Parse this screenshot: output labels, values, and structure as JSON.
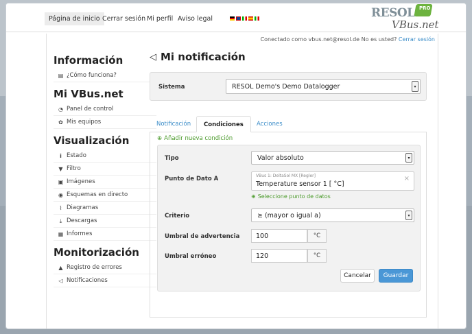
{
  "nav": {
    "home": "Página de inicio",
    "logout": "Cerrar sesión",
    "profile": "Mi perfil",
    "legal": "Aviso legal"
  },
  "logo": {
    "brand": "RESOL",
    "badge": "PRO",
    "product": "VBus.net"
  },
  "connection": {
    "text": "Conectado como vbus.net@resol.de No es usted?",
    "link": "Cerrar sesión"
  },
  "sidebar": {
    "info_title": "Información",
    "info_items": [
      {
        "label": "¿Cómo funciona?",
        "icon": "book-icon"
      }
    ],
    "vbus_title": "Mi VBus.net",
    "vbus_items": [
      {
        "label": "Panel de control",
        "icon": "dashboard-icon"
      },
      {
        "label": "Mis equipos",
        "icon": "gear-icon"
      }
    ],
    "vis_title": "Visualización",
    "vis_items": [
      {
        "label": "Estado",
        "icon": "info-icon"
      },
      {
        "label": "Filtro",
        "icon": "filter-icon"
      },
      {
        "label": "Imágenes",
        "icon": "image-icon"
      },
      {
        "label": "Esquemas en directo",
        "icon": "eye-icon"
      },
      {
        "label": "Diagramas",
        "icon": "chart-icon"
      },
      {
        "label": "Descargas",
        "icon": "download-icon"
      },
      {
        "label": "Informes",
        "icon": "report-icon"
      }
    ],
    "mon_title": "Monitorización",
    "mon_items": [
      {
        "label": "Registro de errores",
        "icon": "warning-icon"
      },
      {
        "label": "Notificaciones",
        "icon": "megaphone-icon"
      }
    ]
  },
  "main": {
    "title": "Mi notificación",
    "system_label": "Sistema",
    "system_value": "RESOL Demo's Demo Datalogger",
    "tabs": [
      "Notificación",
      "Condiciones",
      "Acciones"
    ],
    "active_tab": "Condiciones",
    "add_condition": "Añadir nueva condición",
    "type_label": "Tipo",
    "type_value": "Valor absoluto",
    "datapoint_label": "Punto de Dato A",
    "datapoint_small": "VBus 1: DeltaSol MX [Regler]",
    "datapoint_value": "Temperature sensor 1 [ °C]",
    "select_datapoint": "Seleccione punto de datos",
    "criterion_label": "Criterio",
    "criterion_value": "≥ (mayor o igual a)",
    "warn_label": "Umbral de advertencia",
    "warn_value": "100",
    "warn_unit": "°C",
    "error_label": "Umbral erróneo",
    "error_value": "120",
    "error_unit": "°C",
    "cancel": "Cancelar",
    "save": "Guardar"
  },
  "colors": {
    "accent": "#4a97d6",
    "green": "#4a9a2a",
    "link": "#3a8cc8"
  }
}
